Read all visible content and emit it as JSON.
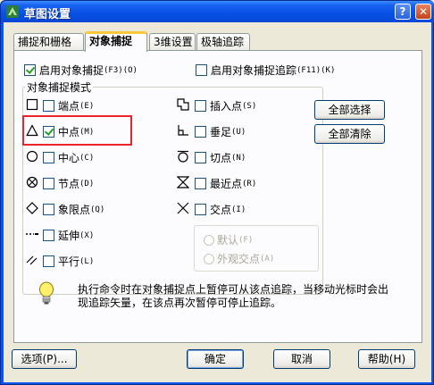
{
  "window": {
    "title": "草图设置",
    "help_glyph": "?",
    "close_glyph": "✕"
  },
  "tabs": [
    {
      "label": "捕捉和栅格",
      "active": false
    },
    {
      "label": "对象捕捉",
      "active": true
    },
    {
      "label": "3维设置",
      "active": false
    },
    {
      "label": "极轴追踪",
      "active": false
    }
  ],
  "enable_snap": {
    "label": "启用对象捕捉",
    "hotkey": "(F3)(O)",
    "checked": true
  },
  "enable_tracking": {
    "label": "启用对象捕捉追踪",
    "hotkey": "(F11)(K)",
    "checked": false
  },
  "group_title": "对象捕捉模式",
  "modes_left": [
    {
      "label": "端点",
      "hotkey": "(E)",
      "checked": false,
      "icon": "endpoint-square-icon"
    },
    {
      "label": "中点",
      "hotkey": "(M)",
      "checked": true,
      "icon": "midpoint-triangle-icon"
    },
    {
      "label": "中心",
      "hotkey": "(C)",
      "checked": false,
      "icon": "center-circle-icon"
    },
    {
      "label": "节点",
      "hotkey": "(D)",
      "checked": false,
      "icon": "node-icon"
    },
    {
      "label": "象限点",
      "hotkey": "(Q)",
      "checked": false,
      "icon": "quadrant-diamond-icon"
    },
    {
      "label": "延伸",
      "hotkey": "(X)",
      "checked": false,
      "icon": "extension-icon"
    },
    {
      "label": "平行",
      "hotkey": "(L)",
      "checked": false,
      "icon": "parallel-icon"
    }
  ],
  "modes_right": [
    {
      "label": "插入点",
      "hotkey": "(S)",
      "checked": false,
      "icon": "insertion-icon"
    },
    {
      "label": "垂足",
      "hotkey": "(U)",
      "checked": false,
      "icon": "perpendicular-icon"
    },
    {
      "label": "切点",
      "hotkey": "(N)",
      "checked": false,
      "icon": "tangent-icon"
    },
    {
      "label": "最近点",
      "hotkey": "(R)",
      "checked": false,
      "icon": "nearest-icon"
    },
    {
      "label": "交点",
      "hotkey": "(I)",
      "checked": false,
      "icon": "intersection-icon"
    }
  ],
  "radios": [
    {
      "label": "默认",
      "hotkey": "(F)"
    },
    {
      "label": "外观交点",
      "hotkey": "(A)"
    }
  ],
  "buttons": {
    "select_all": "全部选择",
    "clear_all": "全部清除",
    "options": "选项(P)...",
    "ok": "确定",
    "cancel": "取消",
    "help": "帮助(H)"
  },
  "info": {
    "line1": "执行命令时在对象捕捉点上暂停可从该点追踪，当移动光标时会出",
    "line2": "现追踪矢量，在该点再次暂停可停止追踪。"
  },
  "colors": {
    "highlight": "#E8262A",
    "check": "#21A121"
  }
}
